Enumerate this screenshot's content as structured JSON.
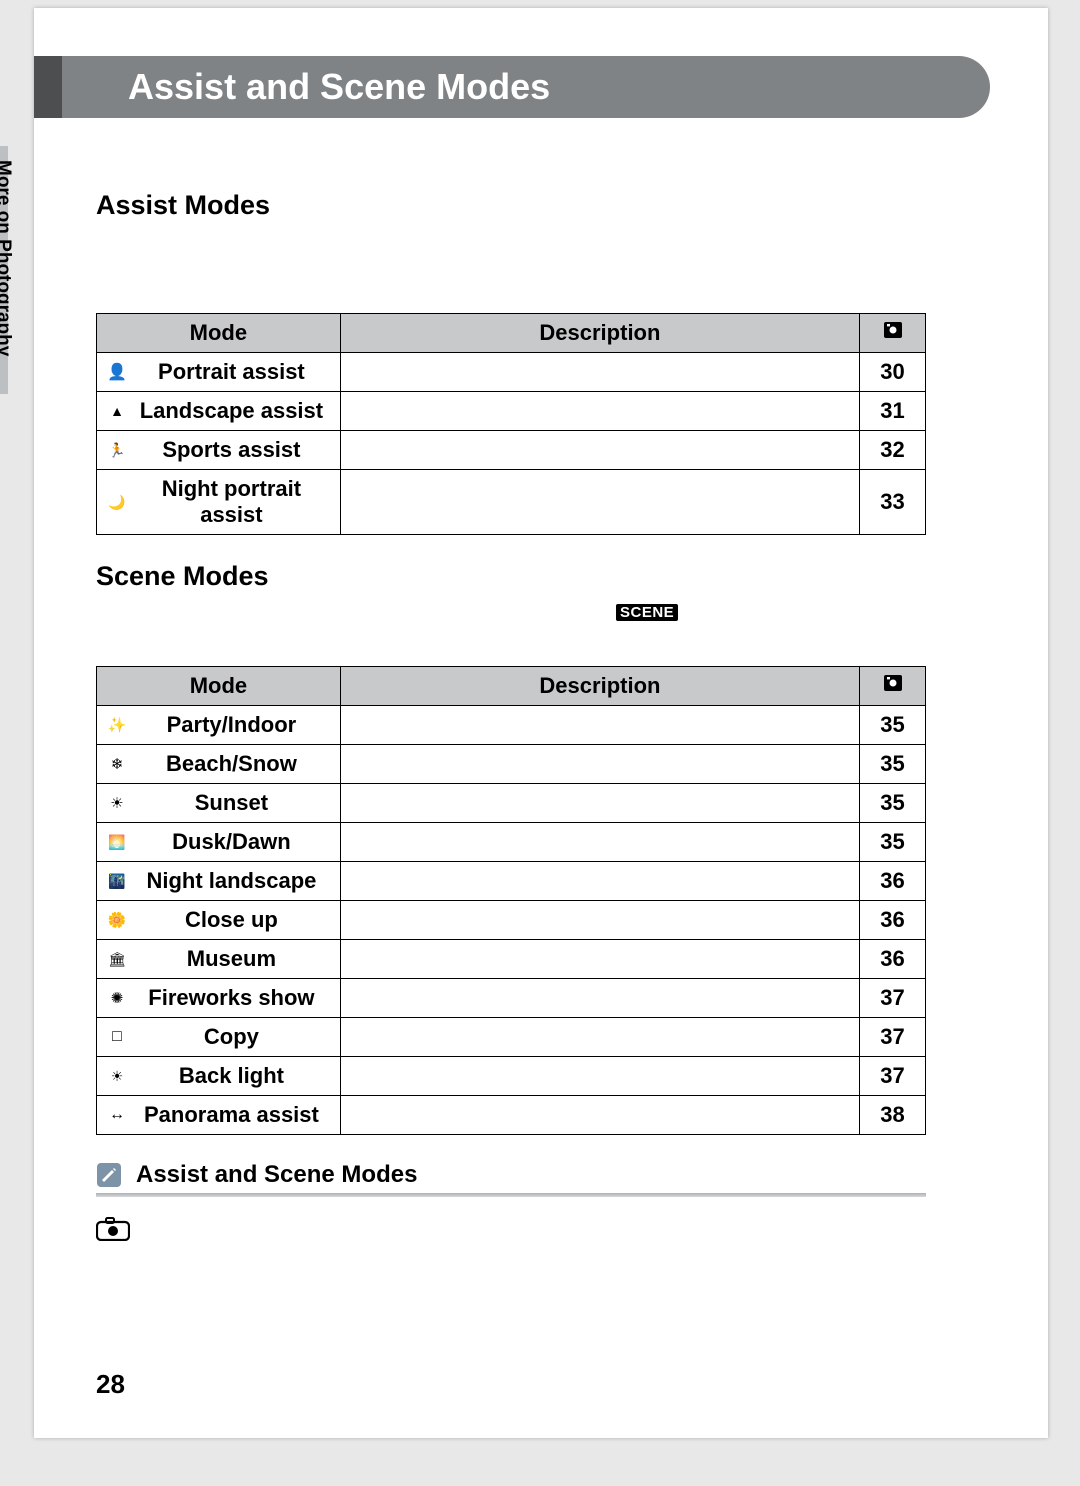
{
  "header": {
    "title": "Assist and Scene Modes"
  },
  "sidebar": {
    "label": "More on Photography"
  },
  "page_number": "28",
  "assist": {
    "heading": "Assist Modes",
    "columns": {
      "mode": "Mode",
      "desc": "Description",
      "page_icon": "⧉"
    },
    "rows": [
      {
        "icon": "portrait-assist-icon",
        "label": "Portrait assist",
        "desc": "",
        "page": "30"
      },
      {
        "icon": "landscape-assist-icon",
        "label": "Landscape assist",
        "desc": "",
        "page": "31"
      },
      {
        "icon": "sports-assist-icon",
        "label": "Sports assist",
        "desc": "",
        "page": "32"
      },
      {
        "icon": "night-portrait-assist-icon",
        "label": "Night portrait assist",
        "desc": "",
        "page": "33"
      }
    ]
  },
  "scene": {
    "heading": "Scene Modes",
    "badge": "SCENE",
    "columns": {
      "mode": "Mode",
      "desc": "Description",
      "page_icon": "⧉"
    },
    "rows": [
      {
        "icon": "party-indoor-icon",
        "label": "Party/Indoor",
        "desc": "",
        "page": "35"
      },
      {
        "icon": "beach-snow-icon",
        "label": "Beach/Snow",
        "desc": "",
        "page": "35"
      },
      {
        "icon": "sunset-icon",
        "label": "Sunset",
        "desc": "",
        "page": "35"
      },
      {
        "icon": "dusk-dawn-icon",
        "label": "Dusk/Dawn",
        "desc": "",
        "page": "35"
      },
      {
        "icon": "night-landscape-icon",
        "label": "Night landscape",
        "desc": "",
        "page": "36"
      },
      {
        "icon": "close-up-icon",
        "label": "Close up",
        "desc": "",
        "page": "36"
      },
      {
        "icon": "museum-icon",
        "label": "Museum",
        "desc": "",
        "page": "36"
      },
      {
        "icon": "fireworks-show-icon",
        "label": "Fireworks show",
        "desc": "",
        "page": "37"
      },
      {
        "icon": "copy-icon",
        "label": "Copy",
        "desc": "",
        "page": "37"
      },
      {
        "icon": "back-light-icon",
        "label": "Back light",
        "desc": "",
        "page": "37"
      },
      {
        "icon": "panorama-assist-icon",
        "label": "Panorama assist",
        "desc": "",
        "page": "38"
      }
    ]
  },
  "note": {
    "title": "Assist and Scene Modes",
    "body_prefix": "",
    "body_suffix": ""
  }
}
